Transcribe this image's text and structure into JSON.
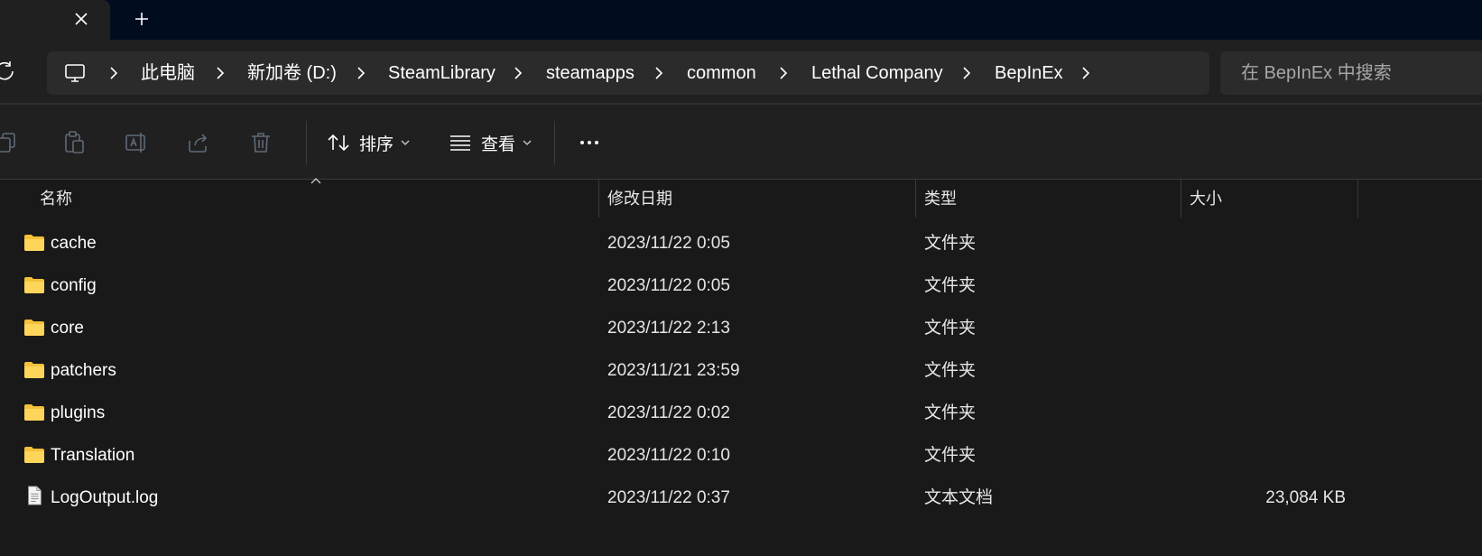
{
  "tabs": {
    "close_label": "✕",
    "new_tab_label": "+"
  },
  "breadcrumbs": [
    {
      "label": "此电脑"
    },
    {
      "label": "新加卷 (D:)"
    },
    {
      "label": "SteamLibrary"
    },
    {
      "label": "steamapps"
    },
    {
      "label": "common"
    },
    {
      "label": "Lethal Company"
    },
    {
      "label": "BepInEx"
    }
  ],
  "search": {
    "placeholder": "在 BepInEx 中搜索"
  },
  "toolbar": {
    "sort_label": "排序",
    "view_label": "查看"
  },
  "columns": {
    "name": "名称",
    "modified": "修改日期",
    "type": "类型",
    "size": "大小"
  },
  "files": [
    {
      "name": "cache",
      "modified": "2023/11/22 0:05",
      "type": "文件夹",
      "size": "",
      "icon": "folder-icon"
    },
    {
      "name": "config",
      "modified": "2023/11/22 0:05",
      "type": "文件夹",
      "size": "",
      "icon": "folder-icon"
    },
    {
      "name": "core",
      "modified": "2023/11/22 2:13",
      "type": "文件夹",
      "size": "",
      "icon": "folder-icon"
    },
    {
      "name": "patchers",
      "modified": "2023/11/21 23:59",
      "type": "文件夹",
      "size": "",
      "icon": "folder-icon"
    },
    {
      "name": "plugins",
      "modified": "2023/11/22 0:02",
      "type": "文件夹",
      "size": "",
      "icon": "folder-icon"
    },
    {
      "name": "Translation",
      "modified": "2023/11/22 0:10",
      "type": "文件夹",
      "size": "",
      "icon": "folder-icon"
    },
    {
      "name": "LogOutput.log",
      "modified": "2023/11/22 0:37",
      "type": "文本文档",
      "size": "23,084 KB",
      "icon": "text-file-icon"
    }
  ],
  "colors": {
    "titlebar": "#020c1f",
    "chrome": "#202020",
    "content": "#191919",
    "folder": "#f3c13a"
  }
}
